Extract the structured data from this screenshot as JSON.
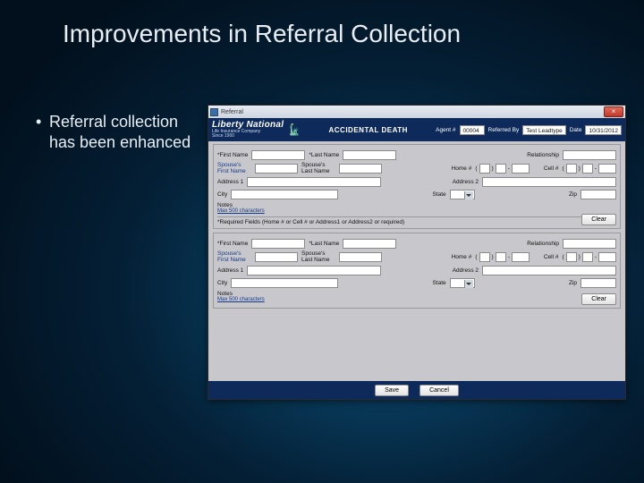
{
  "slide": {
    "title": "Improvements in Referral Collection",
    "bullet": "Referral collection has been enhanced"
  },
  "app": {
    "window_title": "Referral",
    "close_glyph": "×",
    "brand": {
      "name": "Liberty National",
      "subtitle": "Life Insurance Company",
      "since": "Since 1900"
    },
    "header_title": "ACCIDENTAL DEATH",
    "meta": {
      "agent_label": "Agent #",
      "agent_value": "00004",
      "referred_label": "Referred By",
      "referred_value": "Test Leadtype",
      "date_label": "Date",
      "date_value": "10/31/2012"
    },
    "labels": {
      "first_name": "*First Name",
      "last_name": "*Last Name",
      "relationship": "Relationship",
      "spouse_first": "Spouse's First Name",
      "spouse_last": "Spouse's Last Name",
      "home": "Home #",
      "cell": "Cell #",
      "addr1": "Address 1",
      "addr2": "Address 2",
      "city": "City",
      "state": "State",
      "zip": "Zip",
      "notes": "Notes",
      "chars_link": "Max 500 characters",
      "required_note": "*Required Fields (Home # or Cell # or Address1 or Address2 or required)"
    },
    "buttons": {
      "clear": "Clear",
      "save": "Save",
      "cancel": "Cancel"
    },
    "phone_paren_l": "(",
    "phone_paren_r": ")",
    "phone_dash": "-"
  }
}
